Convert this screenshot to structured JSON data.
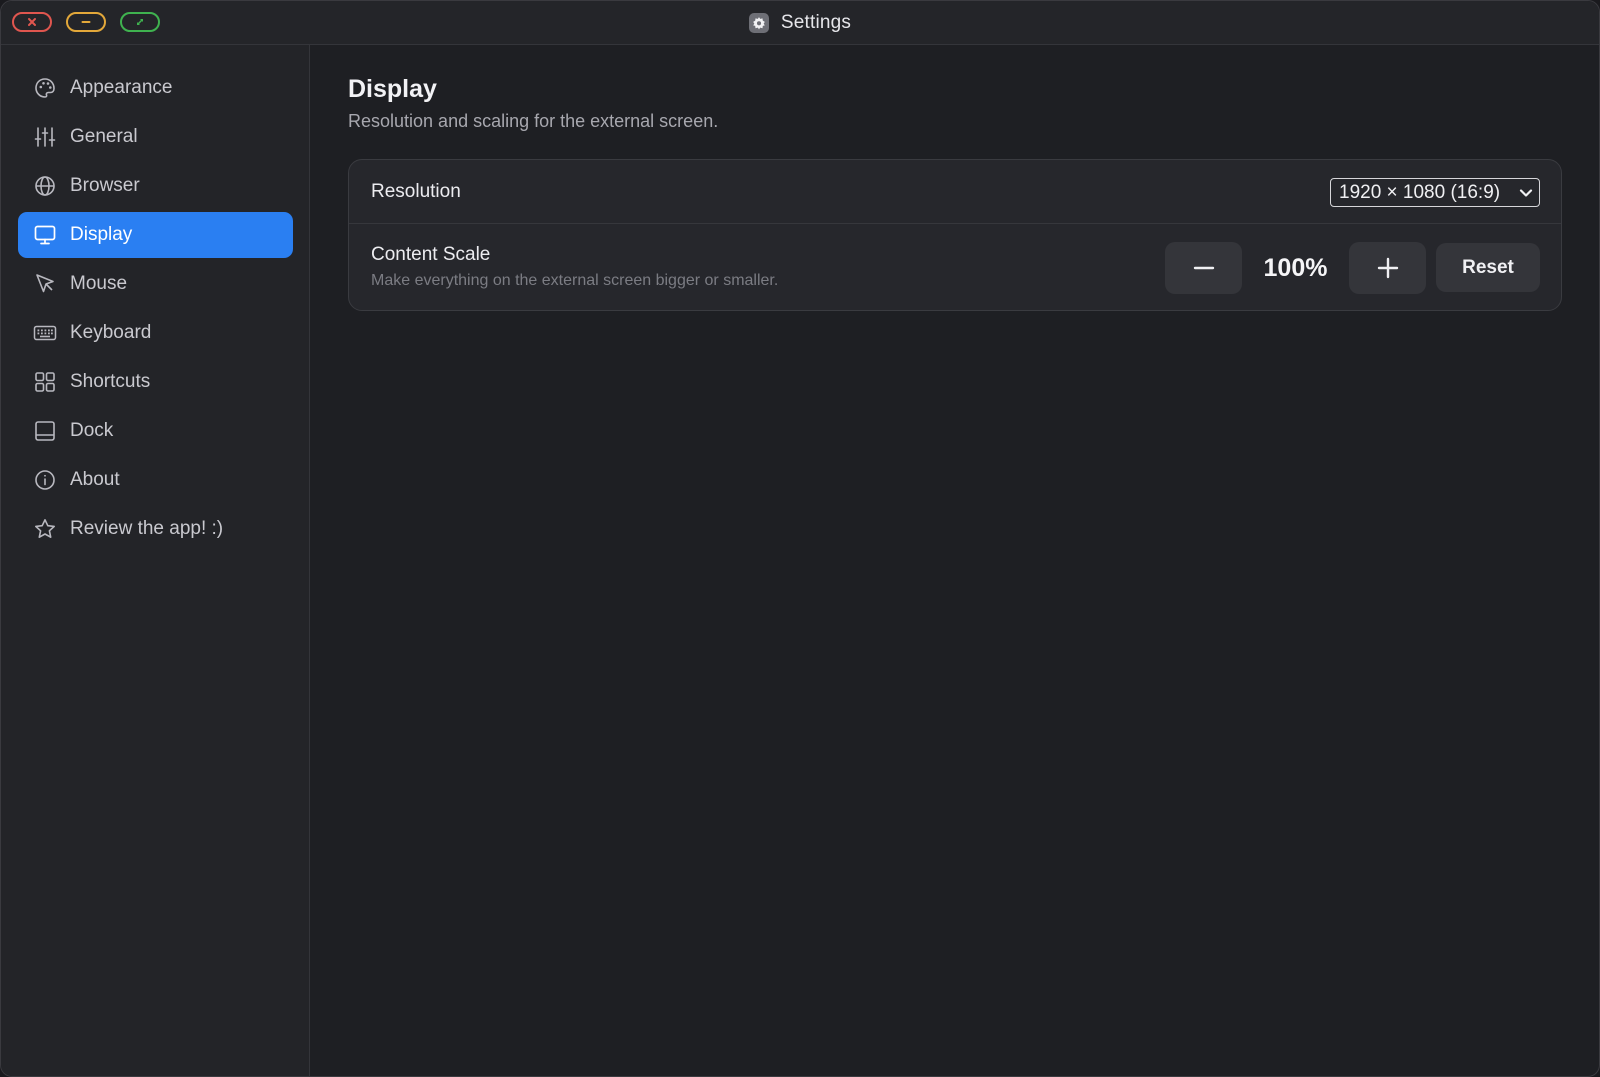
{
  "window": {
    "title": "Settings",
    "app_icon": "gear-icon"
  },
  "traffic_lights": {
    "close": {
      "icon": "close-icon",
      "color": "#e0564f"
    },
    "minimize": {
      "icon": "minimize-icon",
      "color": "#e3a83a"
    },
    "zoom": {
      "icon": "fullscreen-icon",
      "color": "#3fb24f"
    }
  },
  "sidebar": {
    "selected": "Display",
    "accent_color": "#2a7ff2",
    "items": [
      {
        "label": "Appearance",
        "icon": "palette-icon"
      },
      {
        "label": "General",
        "icon": "sliders-icon"
      },
      {
        "label": "Browser",
        "icon": "globe-icon"
      },
      {
        "label": "Display",
        "icon": "monitor-icon"
      },
      {
        "label": "Mouse",
        "icon": "cursor-icon"
      },
      {
        "label": "Keyboard",
        "icon": "keyboard-icon"
      },
      {
        "label": "Shortcuts",
        "icon": "grid-icon"
      },
      {
        "label": "Dock",
        "icon": "dock-icon"
      },
      {
        "label": "About",
        "icon": "info-icon"
      },
      {
        "label": "Review the app! :)",
        "icon": "star-icon"
      }
    ]
  },
  "main": {
    "title": "Display",
    "subtitle": "Resolution and scaling for the external screen.",
    "resolution": {
      "label": "Resolution",
      "selected_value": "1920 × 1080 (16:9)"
    },
    "content_scale": {
      "label": "Content Scale",
      "description": "Make everything on the external screen bigger or smaller.",
      "value": "100%",
      "decrease_icon": "minus-icon",
      "increase_icon": "plus-icon",
      "reset_label": "Reset"
    }
  }
}
